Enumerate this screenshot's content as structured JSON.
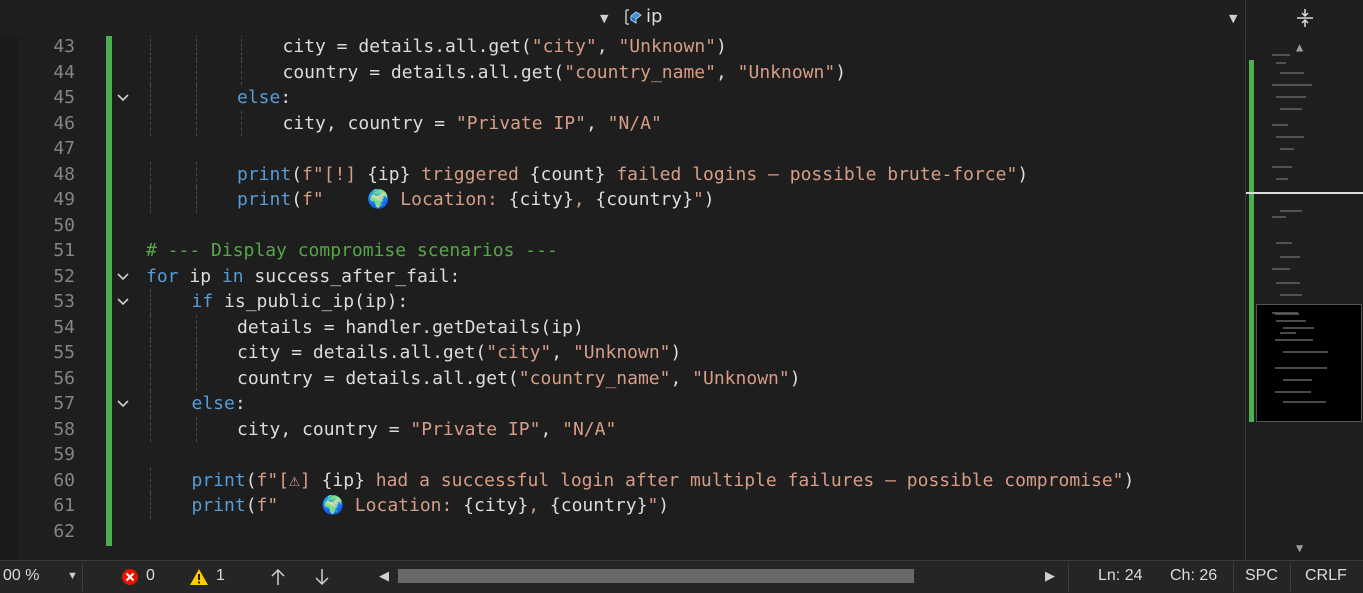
{
  "navbar": {
    "member_dropdown_value": "ip"
  },
  "editor": {
    "lines": [
      {
        "num": "43",
        "indent": 3,
        "fold": false,
        "tokens": [
          [
            "var",
            "city = details.all.get("
          ],
          [
            "str",
            "\"city\""
          ],
          [
            "var",
            ", "
          ],
          [
            "str",
            "\"Unknown\""
          ],
          [
            "var",
            ")"
          ]
        ]
      },
      {
        "num": "44",
        "indent": 3,
        "fold": false,
        "tokens": [
          [
            "var",
            "country = details.all.get("
          ],
          [
            "str",
            "\"country_name\""
          ],
          [
            "var",
            ", "
          ],
          [
            "str",
            "\"Unknown\""
          ],
          [
            "var",
            ")"
          ]
        ]
      },
      {
        "num": "45",
        "indent": 2,
        "fold": true,
        "tokens": [
          [
            "kw",
            "else"
          ],
          [
            "var",
            ":"
          ]
        ]
      },
      {
        "num": "46",
        "indent": 3,
        "fold": false,
        "tokens": [
          [
            "var",
            "city, country = "
          ],
          [
            "str",
            "\"Private IP\""
          ],
          [
            "var",
            ", "
          ],
          [
            "str",
            "\"N/A\""
          ]
        ]
      },
      {
        "num": "47",
        "indent": 0,
        "fold": false,
        "tokens": []
      },
      {
        "num": "48",
        "indent": 2,
        "fold": false,
        "tokens": [
          [
            "kw",
            "print"
          ],
          [
            "var",
            "("
          ],
          [
            "str",
            "f\"[!] "
          ],
          [
            "var",
            "{ip}"
          ],
          [
            "str",
            " triggered "
          ],
          [
            "var",
            "{count}"
          ],
          [
            "str",
            " failed logins – possible brute-force\""
          ],
          [
            "var",
            ")"
          ]
        ]
      },
      {
        "num": "49",
        "indent": 2,
        "fold": false,
        "tokens": [
          [
            "kw",
            "print"
          ],
          [
            "var",
            "("
          ],
          [
            "str",
            "f\"    🌍 Location: "
          ],
          [
            "var",
            "{city}"
          ],
          [
            "str",
            ", "
          ],
          [
            "var",
            "{country}"
          ],
          [
            "str",
            "\""
          ],
          [
            "var",
            ")"
          ]
        ]
      },
      {
        "num": "50",
        "indent": 0,
        "fold": false,
        "tokens": []
      },
      {
        "num": "51",
        "indent": 0,
        "fold": false,
        "tokens": [
          [
            "cm",
            "# --- Display compromise scenarios ---"
          ]
        ]
      },
      {
        "num": "52",
        "indent": 0,
        "fold": true,
        "tokens": [
          [
            "kw",
            "for"
          ],
          [
            "var",
            " ip "
          ],
          [
            "kw",
            "in"
          ],
          [
            "var",
            " success_after_fail:"
          ]
        ]
      },
      {
        "num": "53",
        "indent": 1,
        "fold": true,
        "tokens": [
          [
            "kw",
            "if"
          ],
          [
            "var",
            " is_public_ip(ip):"
          ]
        ]
      },
      {
        "num": "54",
        "indent": 2,
        "fold": false,
        "tokens": [
          [
            "var",
            "details = handler.getDetails(ip)"
          ]
        ]
      },
      {
        "num": "55",
        "indent": 2,
        "fold": false,
        "tokens": [
          [
            "var",
            "city = details.all.get("
          ],
          [
            "str",
            "\"city\""
          ],
          [
            "var",
            ", "
          ],
          [
            "str",
            "\"Unknown\""
          ],
          [
            "var",
            ")"
          ]
        ]
      },
      {
        "num": "56",
        "indent": 2,
        "fold": false,
        "tokens": [
          [
            "var",
            "country = details.all.get("
          ],
          [
            "str",
            "\"country_name\""
          ],
          [
            "var",
            ", "
          ],
          [
            "str",
            "\"Unknown\""
          ],
          [
            "var",
            ")"
          ]
        ]
      },
      {
        "num": "57",
        "indent": 1,
        "fold": true,
        "tokens": [
          [
            "kw",
            "else"
          ],
          [
            "var",
            ":"
          ]
        ]
      },
      {
        "num": "58",
        "indent": 2,
        "fold": false,
        "tokens": [
          [
            "var",
            "city, country = "
          ],
          [
            "str",
            "\"Private IP\""
          ],
          [
            "var",
            ", "
          ],
          [
            "str",
            "\"N/A\""
          ]
        ]
      },
      {
        "num": "59",
        "indent": 0,
        "fold": false,
        "tokens": []
      },
      {
        "num": "60",
        "indent": 1,
        "fold": false,
        "tokens": [
          [
            "kw",
            "print"
          ],
          [
            "var",
            "("
          ],
          [
            "str",
            "f\"[⚠] "
          ],
          [
            "var",
            "{ip}"
          ],
          [
            "str",
            " had a successful login after multiple failures – possible compromise\""
          ],
          [
            "var",
            ")"
          ]
        ]
      },
      {
        "num": "61",
        "indent": 1,
        "fold": false,
        "tokens": [
          [
            "kw",
            "print"
          ],
          [
            "var",
            "("
          ],
          [
            "str",
            "f\"    🌍 Location: "
          ],
          [
            "var",
            "{city}"
          ],
          [
            "str",
            ", "
          ],
          [
            "var",
            "{country}"
          ],
          [
            "str",
            "\""
          ],
          [
            "var",
            ")"
          ]
        ]
      },
      {
        "num": "62",
        "indent": 0,
        "fold": false,
        "tokens": []
      }
    ]
  },
  "statusbar": {
    "zoom": "00 %",
    "errors": "0",
    "warnings": "1",
    "line": "Ln: 24",
    "char": "Ch: 26",
    "indent_mode": "SPC",
    "line_ending": "CRLF"
  },
  "colors": {
    "keyword": "#569cd6",
    "string": "#d69d85",
    "comment": "#57a64a",
    "change_marker": "#4caf50",
    "error": "#e51400",
    "warning": "#ffcc00"
  }
}
